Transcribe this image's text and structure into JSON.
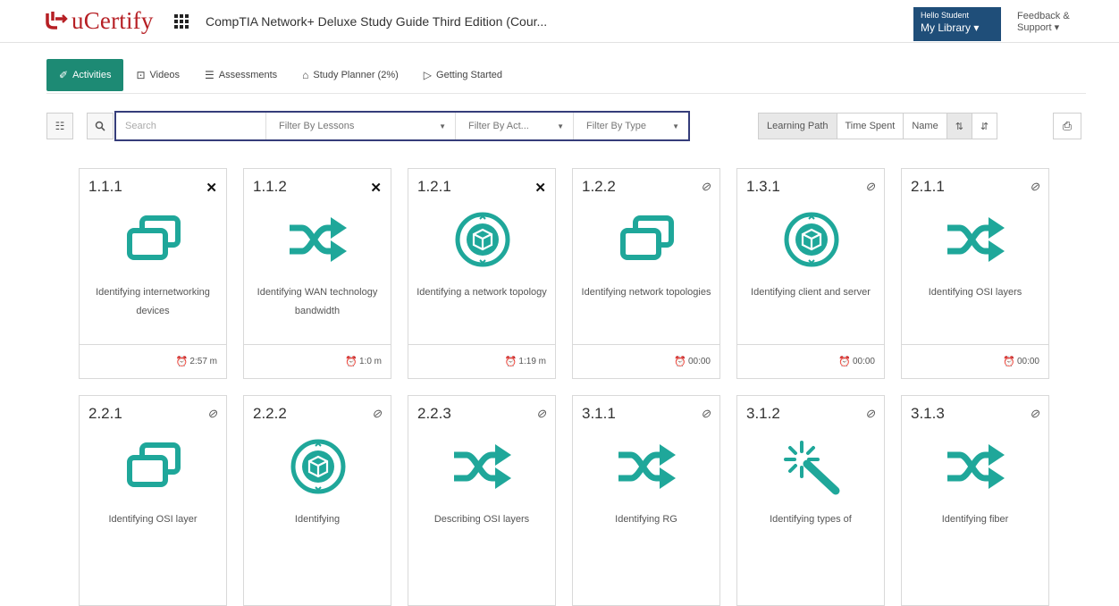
{
  "app": {
    "logo_text": "uCertify",
    "course_title": "CompTIA Network+ Deluxe Study Guide Third Edition (Cour...",
    "brand_color": "#b61f24",
    "accent_color": "#1d8a74"
  },
  "user": {
    "greeting": "Hello Student",
    "library_label": "My Library ▾"
  },
  "support": {
    "line1": "Feedback &",
    "line2": "Support ▾"
  },
  "tabs": [
    {
      "label": "Activities",
      "icon": "pin-icon",
      "active": true
    },
    {
      "label": "Videos",
      "icon": "video-icon",
      "active": false
    },
    {
      "label": "Assessments",
      "icon": "list-icon",
      "active": false
    },
    {
      "label": "Study Planner (2%)",
      "icon": "planner-icon",
      "active": false
    },
    {
      "label": "Getting Started",
      "icon": "play-icon",
      "active": false
    }
  ],
  "toolbar": {
    "search_placeholder": "Search",
    "filter_lessons": "Filter By Lessons",
    "filter_activity": "Filter By Act...",
    "filter_type": "Filter By Type",
    "sort_learning_path": "Learning Path",
    "sort_time_spent": "Time Spent",
    "sort_name": "Name",
    "sort_asc_icon": "sort-ascending-icon",
    "sort_desc_icon": "sort-descending-icon",
    "print_icon": "print-icon"
  },
  "cards": [
    {
      "num": "1.1.1",
      "status": "✕",
      "icon": "windows-icon",
      "title": "Identifying internetworking devices",
      "time": "2:57 m"
    },
    {
      "num": "1.1.2",
      "status": "✕",
      "icon": "shuffle-icon",
      "title": "Identifying WAN technology bandwidth",
      "time": "1:0 m"
    },
    {
      "num": "1.2.1",
      "status": "✕",
      "icon": "cube-icon",
      "title": "Identifying a network topology",
      "time": "1:19 m"
    },
    {
      "num": "1.2.2",
      "status": "⊘",
      "icon": "windows-icon",
      "title": "Identifying network topologies",
      "time": "00:00"
    },
    {
      "num": "1.3.1",
      "status": "⊘",
      "icon": "cube-icon",
      "title": "Identifying client and server",
      "time": "00:00"
    },
    {
      "num": "2.1.1",
      "status": "⊘",
      "icon": "shuffle-icon",
      "title": "Identifying OSI layers",
      "time": "00:00"
    },
    {
      "num": "2.2.1",
      "status": "⊘",
      "icon": "windows-icon",
      "title": "Identifying OSI layer",
      "time": ""
    },
    {
      "num": "2.2.2",
      "status": "⊘",
      "icon": "cube-icon",
      "title": "Identifying",
      "time": ""
    },
    {
      "num": "2.2.3",
      "status": "⊘",
      "icon": "shuffle-icon",
      "title": "Describing OSI layers",
      "time": ""
    },
    {
      "num": "3.1.1",
      "status": "⊘",
      "icon": "shuffle-icon",
      "title": "Identifying RG",
      "time": ""
    },
    {
      "num": "3.1.2",
      "status": "⊘",
      "icon": "magic-wand-icon",
      "title": "Identifying types of",
      "time": ""
    },
    {
      "num": "3.1.3",
      "status": "⊘",
      "icon": "shuffle-icon",
      "title": "Identifying fiber",
      "time": ""
    }
  ]
}
